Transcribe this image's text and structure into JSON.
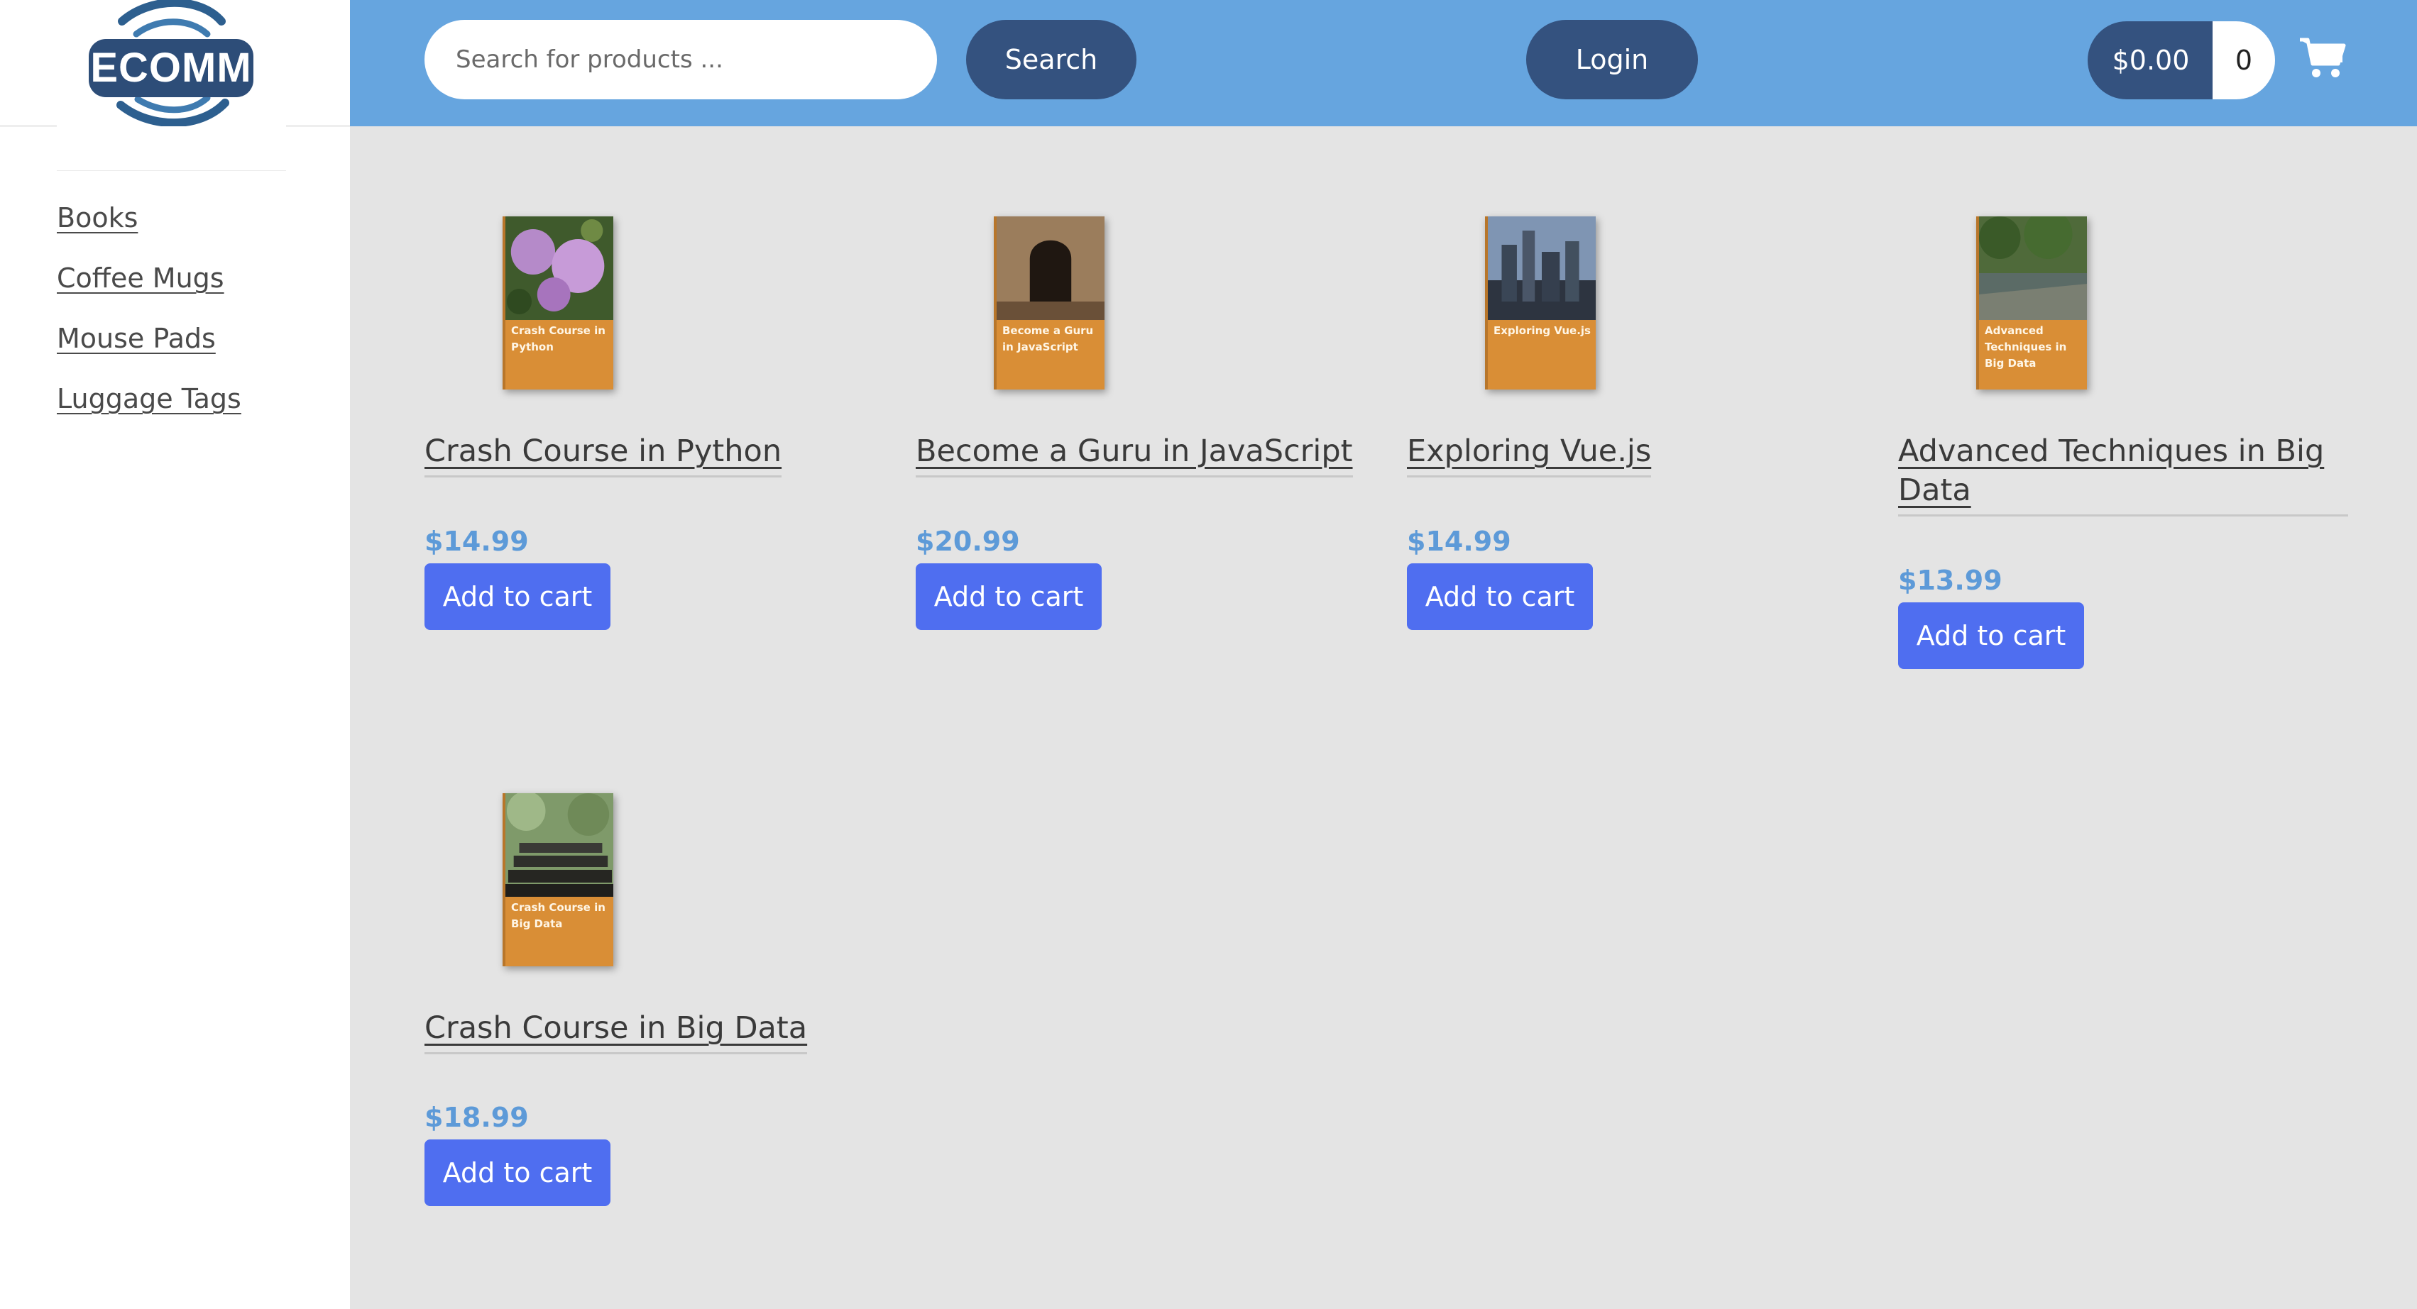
{
  "logo": {
    "text": "ECOMM"
  },
  "sidebar": {
    "categories": [
      {
        "label": "Books"
      },
      {
        "label": "Coffee Mugs"
      },
      {
        "label": "Mouse Pads"
      },
      {
        "label": "Luggage Tags"
      }
    ]
  },
  "header": {
    "search_placeholder": "Search for products ...",
    "search_label": "Search",
    "login_label": "Login",
    "cart_total": "$0.00",
    "cart_count": "0"
  },
  "products": [
    {
      "name": "Crash Course in Python",
      "price": "$14.99",
      "cover_title": "Crash Course in Python",
      "button": "Add to cart"
    },
    {
      "name": "Become a Guru in JavaScript",
      "price": "$20.99",
      "cover_title": "Become a Guru in JavaScript",
      "button": "Add to cart"
    },
    {
      "name": "Exploring Vue.js",
      "price": "$14.99",
      "cover_title": "Exploring Vue.js",
      "button": "Add to cart"
    },
    {
      "name": "Advanced Techniques in Big Data",
      "price": "$13.99",
      "cover_title": "Advanced Techniques in Big Data",
      "button": "Add to cart"
    },
    {
      "name": "Crash Course in Big Data",
      "price": "$18.99",
      "cover_title": "Crash Course in Big Data",
      "button": "Add to cart"
    }
  ],
  "colors": {
    "header": "#66a5df",
    "dark_button": "#34527f",
    "add_button": "#4f6ef0",
    "price": "#5d9ad8",
    "book_cover": "#d98e36"
  }
}
